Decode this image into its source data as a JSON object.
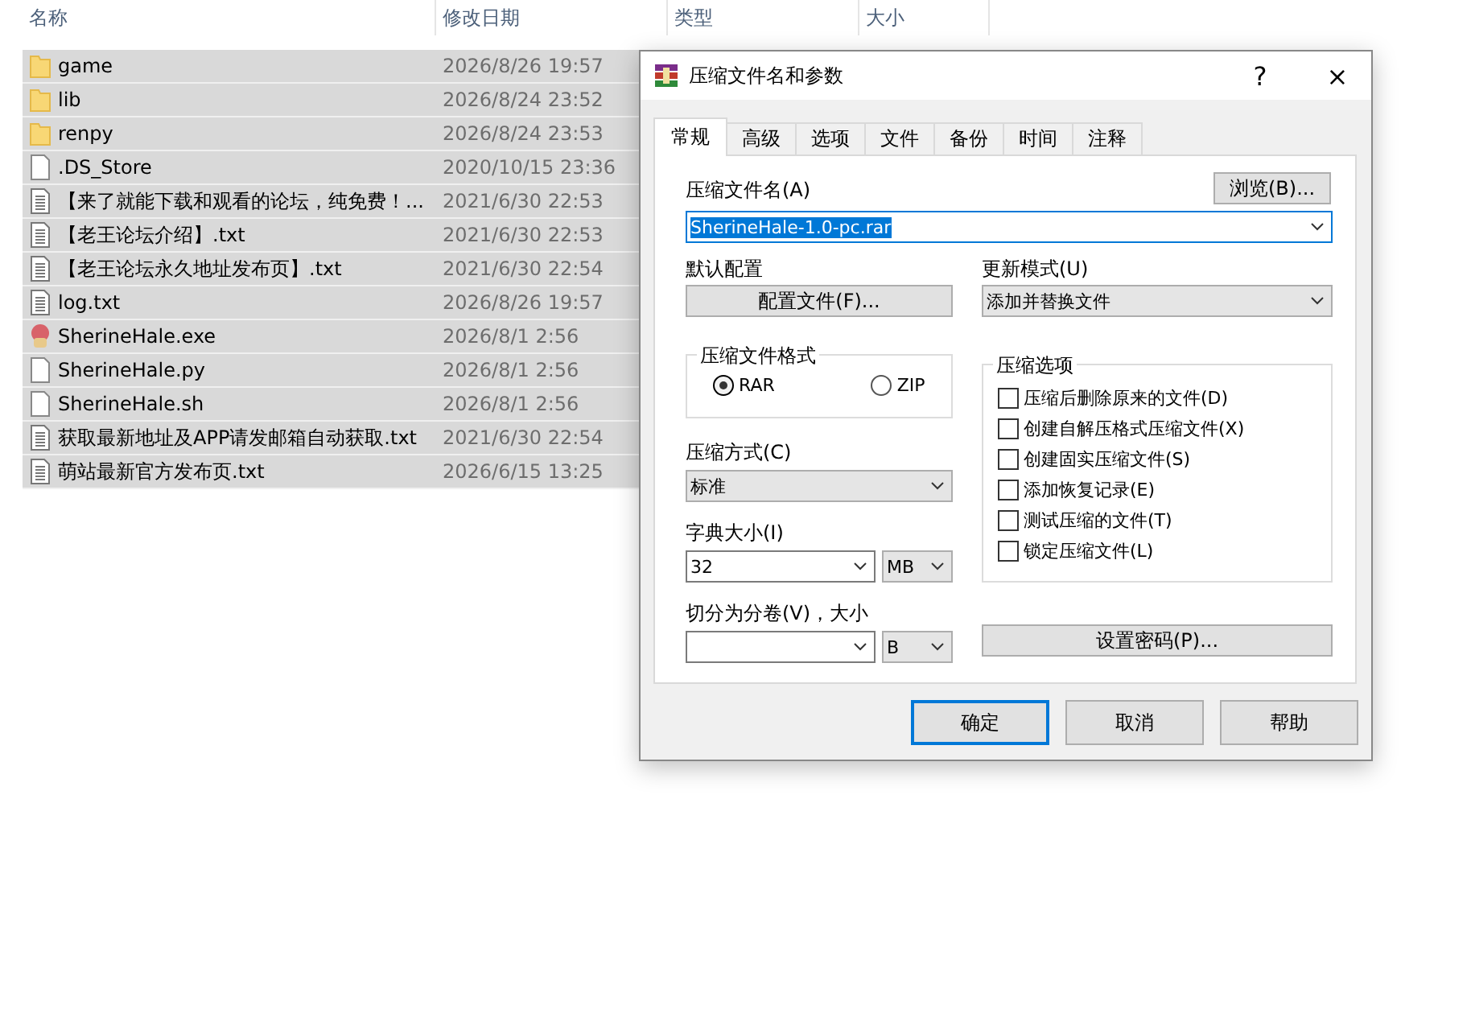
{
  "explorer": {
    "columns": [
      "名称",
      "修改日期",
      "类型",
      "大小"
    ],
    "rows": [
      {
        "kind": "folder",
        "name": "game",
        "date": "2026/8/26 19:57",
        "selected": true
      },
      {
        "kind": "folder",
        "name": "lib",
        "date": "2026/8/24 23:52",
        "selected": true
      },
      {
        "kind": "folder",
        "name": "renpy",
        "date": "2026/8/24 23:53",
        "selected": true
      },
      {
        "kind": "blank",
        "name": ".DS_Store",
        "date": "2020/10/15 23:36",
        "selected": true
      },
      {
        "kind": "text",
        "name": "【来了就能下载和观看的论坛，纯免费！...",
        "date": "2021/6/30 22:53",
        "selected": true
      },
      {
        "kind": "text",
        "name": "【老王论坛介绍】.txt",
        "date": "2021/6/30 22:53",
        "selected": true
      },
      {
        "kind": "text",
        "name": "【老王论坛永久地址发布页】.txt",
        "date": "2021/6/30 22:54",
        "selected": true
      },
      {
        "kind": "text",
        "name": "log.txt",
        "date": "2026/8/26 19:57",
        "selected": true
      },
      {
        "kind": "app",
        "name": "SherineHale.exe",
        "date": "2026/8/1 2:56",
        "selected": true
      },
      {
        "kind": "blank",
        "name": "SherineHale.py",
        "date": "2026/8/1 2:56",
        "selected": true
      },
      {
        "kind": "blank",
        "name": "SherineHale.sh",
        "date": "2026/8/1 2:56",
        "selected": true
      },
      {
        "kind": "text",
        "name": "获取最新地址及APP请发邮箱自动获取.txt",
        "date": "2021/6/30 22:54",
        "selected": true
      },
      {
        "kind": "text",
        "name": "萌站最新官方发布页.txt",
        "date": "2026/6/15 13:25",
        "selected": true
      }
    ]
  },
  "dialog": {
    "title": "压缩文件名和参数",
    "help": "?",
    "close": "×",
    "tabs": [
      {
        "label": "常规",
        "selected": true
      },
      {
        "label": "高级",
        "selected": false
      },
      {
        "label": "选项",
        "selected": false
      },
      {
        "label": "文件",
        "selected": false
      },
      {
        "label": "备份",
        "selected": false
      },
      {
        "label": "时间",
        "selected": false
      },
      {
        "label": "注释",
        "selected": false
      }
    ],
    "archive_name": {
      "label": "压缩文件名(A)",
      "value": "SherineHale-1.0-pc.rar",
      "browse": "浏览(B)..."
    },
    "profile": {
      "label": "默认配置",
      "button": "配置文件(F)..."
    },
    "update_mode": {
      "label": "更新模式(U)",
      "value": "添加并替换文件"
    },
    "format": {
      "label": "压缩文件格式",
      "options": [
        {
          "label": "RAR",
          "selected": true
        },
        {
          "label": "ZIP",
          "selected": false
        }
      ]
    },
    "method": {
      "label": "压缩方式(C)",
      "value": "标准"
    },
    "dictionary": {
      "label": "字典大小(I)",
      "value": "32",
      "unit": "MB"
    },
    "split": {
      "label": "切分为分卷(V)，大小",
      "unit": "B"
    },
    "options": {
      "label": "压缩选项",
      "items": [
        {
          "label": "压缩后删除原来的文件(D)",
          "checked": false
        },
        {
          "label": "创建自解压格式压缩文件(X)",
          "checked": false
        },
        {
          "label": "创建固实压缩文件(S)",
          "checked": false
        },
        {
          "label": "添加恢复记录(E)",
          "checked": false
        },
        {
          "label": "测试压缩的文件(T)",
          "checked": false
        },
        {
          "label": "锁定压缩文件(L)",
          "checked": false
        }
      ]
    },
    "password": "设置密码(P)...",
    "buttons": [
      {
        "label": "确定",
        "default": true
      },
      {
        "label": "取消",
        "default": false
      },
      {
        "label": "帮助",
        "default": false
      }
    ]
  }
}
